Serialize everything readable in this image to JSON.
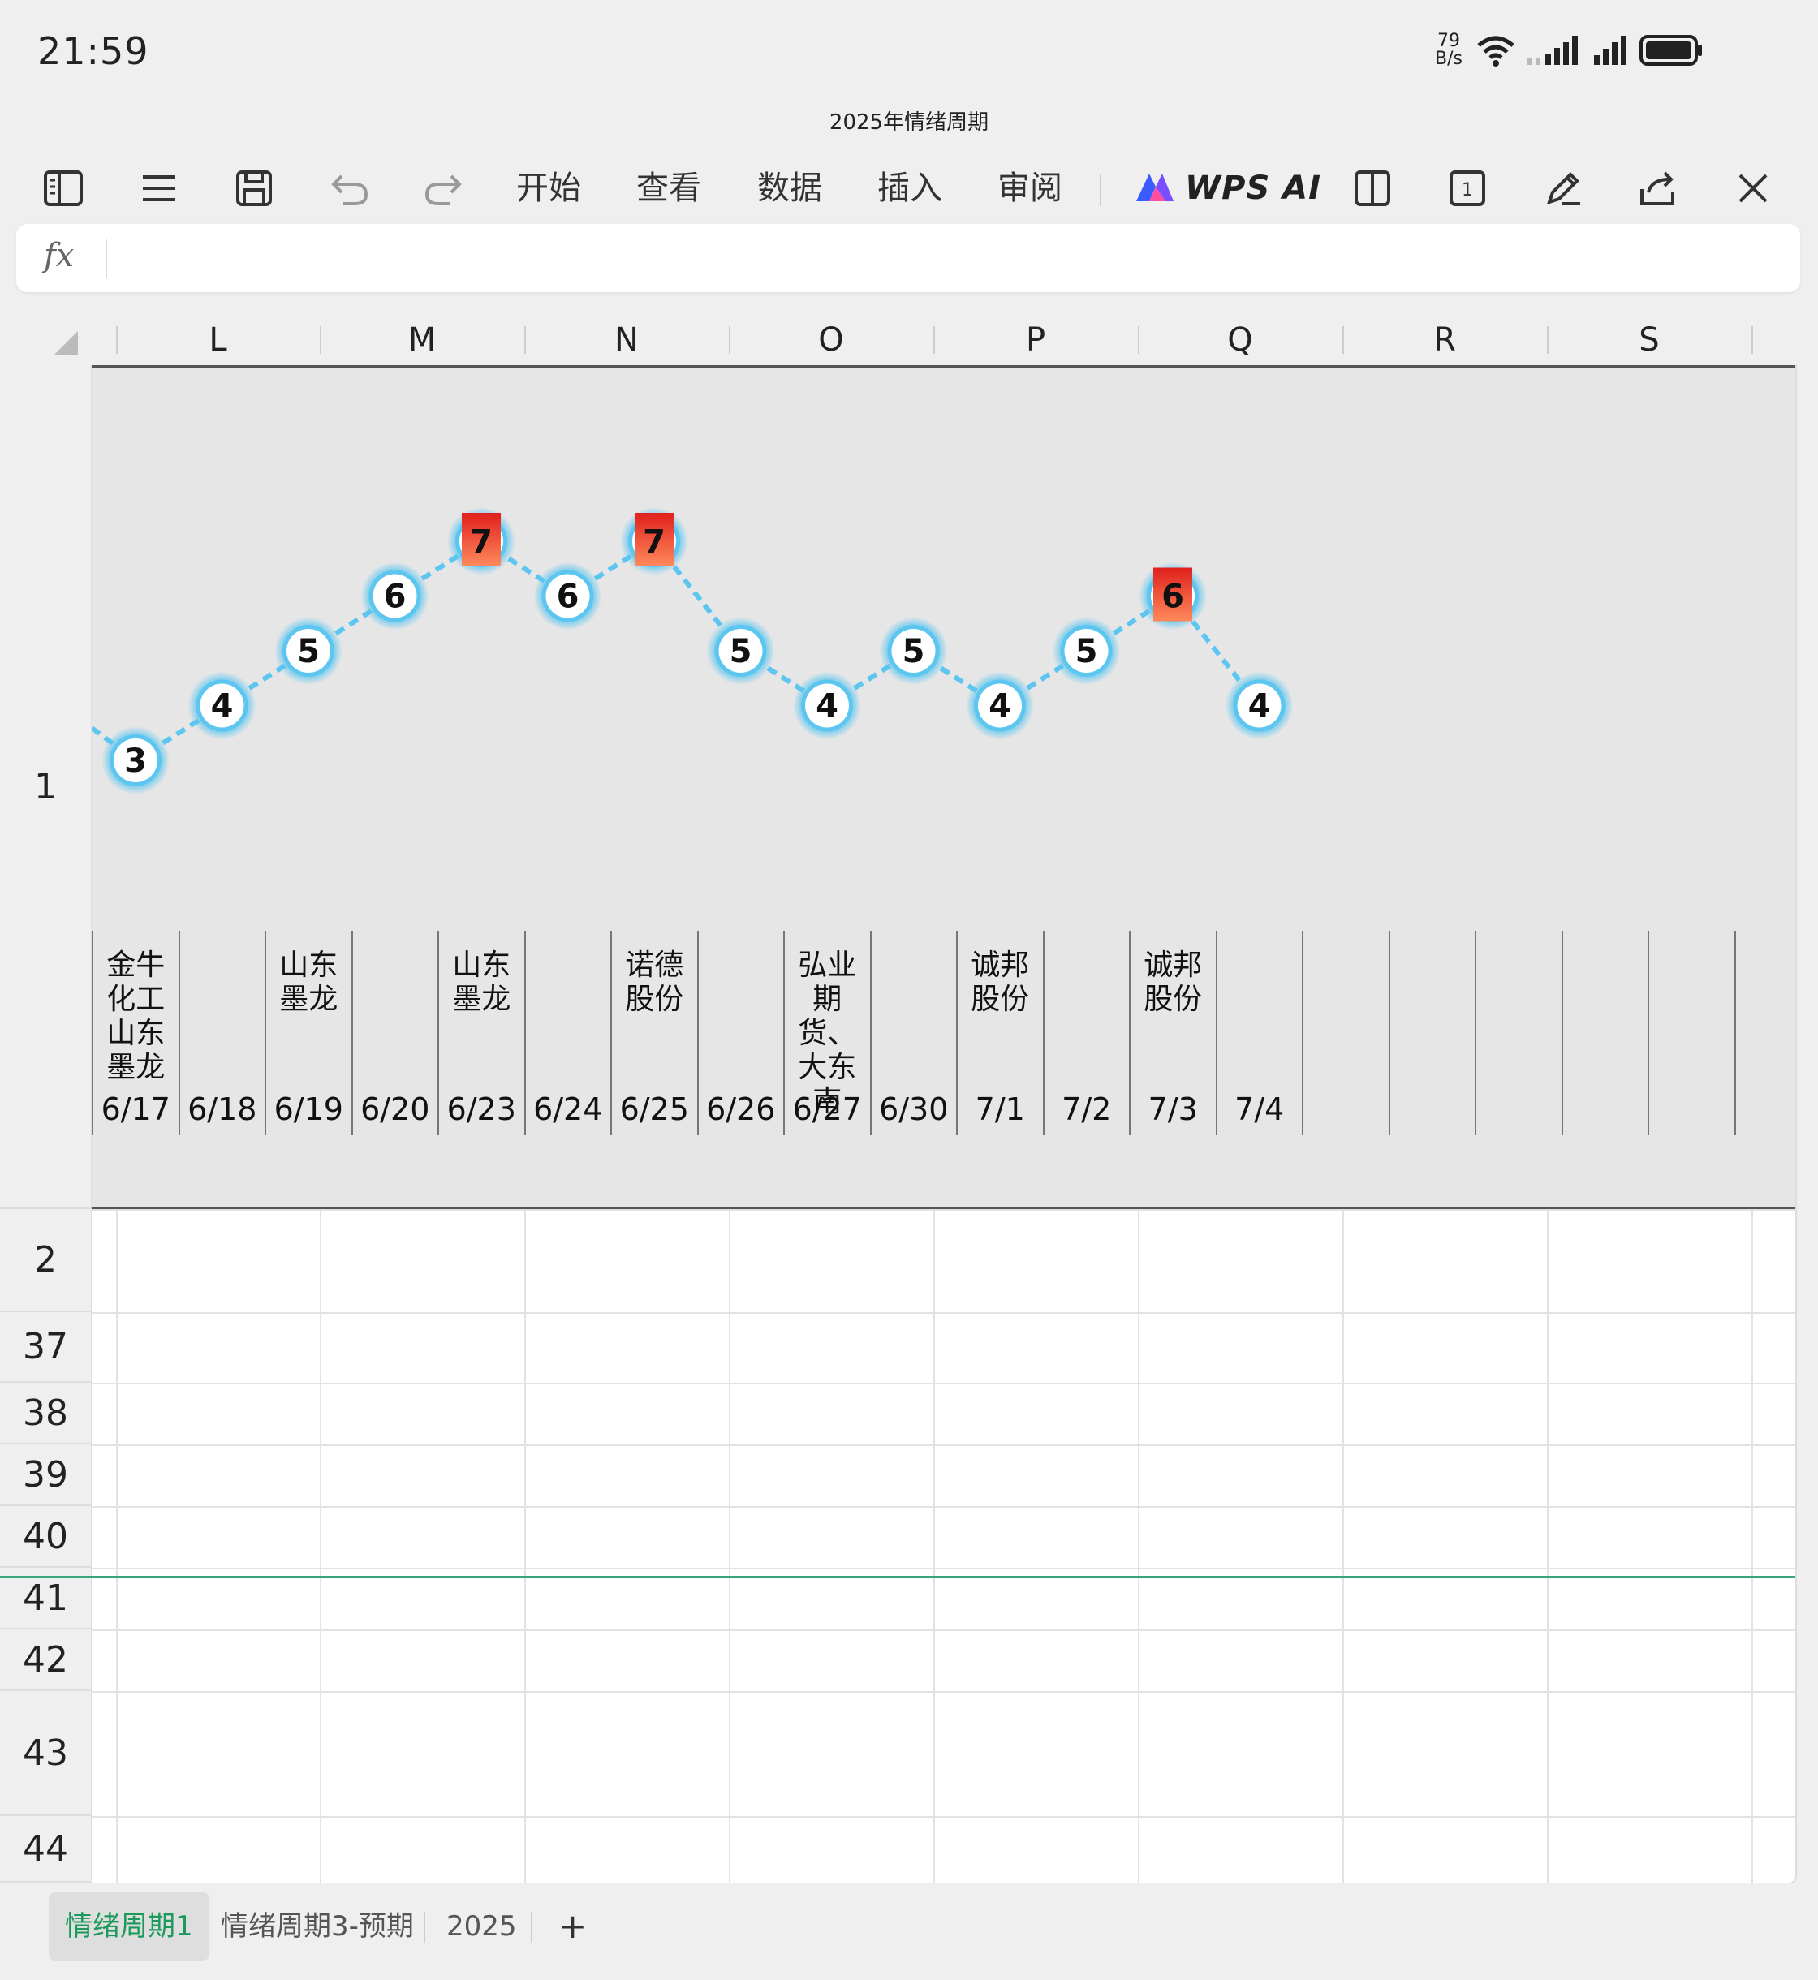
{
  "status_bar": {
    "time": "21:59",
    "net_speed_value": "79",
    "net_speed_unit": "B/s",
    "icons": [
      "wifi-icon",
      "signal-icon",
      "signal-icon",
      "battery-icon"
    ]
  },
  "document": {
    "title": "2025年情绪周期"
  },
  "toolbar": {
    "icons_left": [
      "sidebar-icon",
      "menu-icon",
      "save-icon",
      "undo-icon",
      "redo-icon"
    ],
    "tabs": [
      "开始",
      "查看",
      "数据",
      "插入",
      "审阅"
    ],
    "ai_label": "WPS AI",
    "icons_right": [
      "split-view-icon",
      "page-1-icon",
      "pen-icon",
      "share-icon",
      "close-icon"
    ],
    "page_number": "1"
  },
  "formula_bar": {
    "fx_label": "fx",
    "value": ""
  },
  "columns": [
    "L",
    "M",
    "N",
    "O",
    "P",
    "Q",
    "R",
    "S"
  ],
  "rows": [
    "1",
    "2",
    "37",
    "38",
    "39",
    "40",
    "41",
    "42",
    "43",
    "44"
  ],
  "chart_data": {
    "type": "line",
    "categories": [
      "6/17",
      "6/18",
      "6/19",
      "6/20",
      "6/23",
      "6/24",
      "6/25",
      "6/26",
      "6/27",
      "6/30",
      "7/1",
      "7/2",
      "7/3",
      "7/4"
    ],
    "values": [
      3,
      4,
      5,
      6,
      7,
      6,
      7,
      5,
      4,
      5,
      4,
      5,
      6,
      4
    ],
    "highlighted_values": [
      false,
      false,
      false,
      false,
      true,
      false,
      true,
      false,
      false,
      false,
      false,
      false,
      true,
      false
    ],
    "stock_labels": [
      "金牛\n化工\n山东\n墨龙",
      "",
      "山东\n墨龙",
      "",
      "山东\n墨龙",
      "",
      "诺德\n股份",
      "",
      "弘业\n期货、\n大东\n南",
      "",
      "诚邦\n股份",
      "",
      "诚邦\n股份",
      ""
    ],
    "empty_trailing_columns": 6,
    "line_color": "#5cc6f0",
    "node_fill": "#ffffff",
    "highlight_color": "#e8332a",
    "grid": false
  },
  "sheet_tabs": {
    "tabs": [
      "情绪周期1",
      "情绪周期3-预期",
      "2025"
    ],
    "active_index": 0,
    "add_label": "+"
  }
}
